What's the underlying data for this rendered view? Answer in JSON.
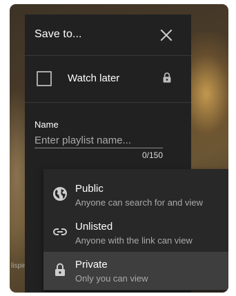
{
  "background": {
    "partial_text": "lispine"
  },
  "dialog": {
    "title": "Save to...",
    "watch_later": {
      "label": "Watch later",
      "checked": false
    },
    "name_field": {
      "label": "Name",
      "placeholder": "Enter playlist name...",
      "value": "",
      "counter": "0/150"
    }
  },
  "privacy_menu": {
    "selected": "Private",
    "options": [
      {
        "title": "Public",
        "subtitle": "Anyone can search for and view",
        "icon": "globe-icon"
      },
      {
        "title": "Unlisted",
        "subtitle": "Anyone with the link can view",
        "icon": "link-icon"
      },
      {
        "title": "Private",
        "subtitle": "Only you can view",
        "icon": "lock-icon"
      }
    ]
  },
  "colors": {
    "dialog_bg": "#212121",
    "menu_bg": "#282828",
    "selected_bg": "#3e3e3e",
    "text_primary": "#ffffff",
    "text_secondary": "#aaaaaa"
  }
}
